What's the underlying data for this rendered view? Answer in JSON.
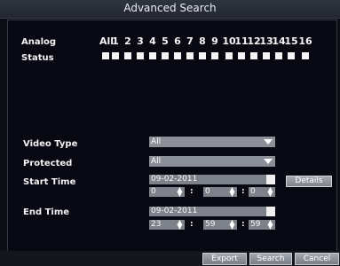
{
  "title": "Advanced Search",
  "analog_label": "Analog",
  "status_label": "Status",
  "channels": [
    "All",
    "1",
    "2",
    "3",
    "4",
    "5",
    "6",
    "7",
    "8",
    "9",
    "10",
    "11",
    "12",
    "13",
    "14",
    "15",
    "16"
  ],
  "video_type": {
    "label": "Video Type",
    "value": "All"
  },
  "protected": {
    "label": "Protected",
    "value": "All"
  },
  "start_time": {
    "label": "Start Time",
    "date": "09-02-2011",
    "hour": "0",
    "minute": "0",
    "second": "0"
  },
  "end_time": {
    "label": "End Time",
    "date": "09-02-2011",
    "hour": "23",
    "minute": "59",
    "second": "59"
  },
  "details_label": "Details",
  "buttons": {
    "export": "Export",
    "search": "Search",
    "cancel": "Cancel"
  },
  "time_separator": ":"
}
